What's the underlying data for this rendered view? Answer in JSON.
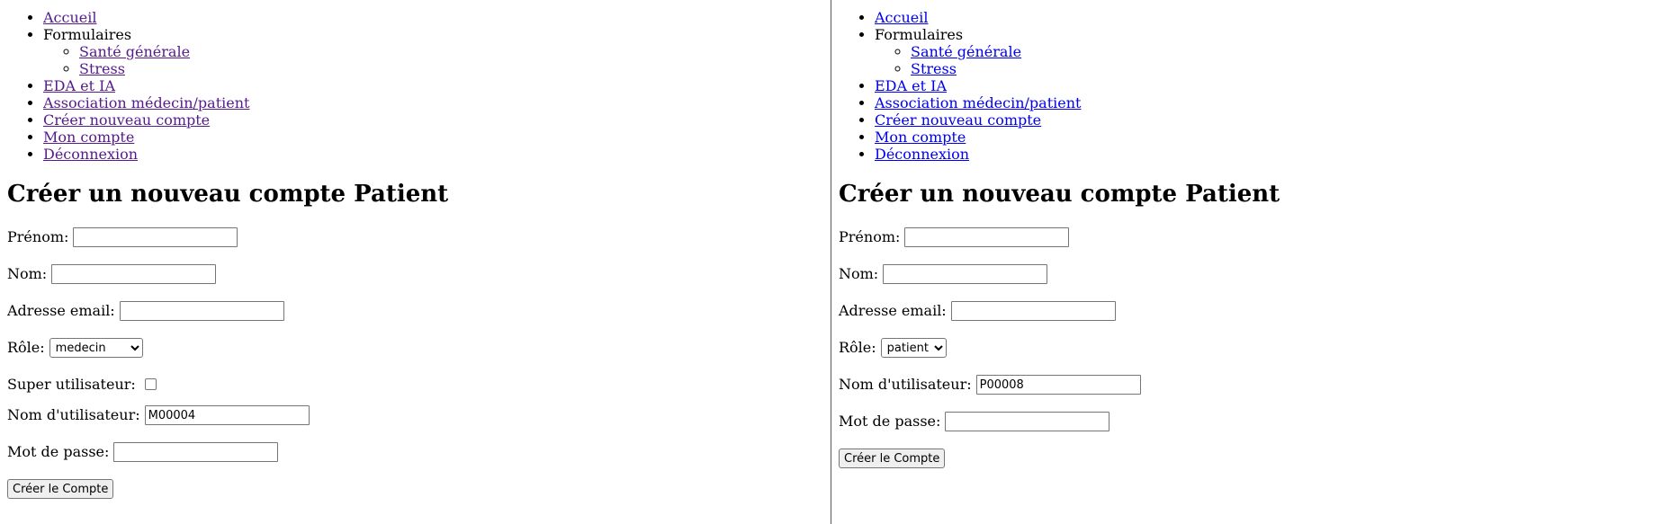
{
  "left": {
    "nav": {
      "accueil": "Accueil",
      "formulaires": "Formulaires",
      "sub": [
        "Santé générale",
        "Stress"
      ],
      "items": [
        "EDA et IA",
        "Association médecin/patient",
        "Créer nouveau compte",
        "Mon compte",
        "Déconnexion"
      ]
    },
    "title": "Créer un nouveau compte Patient",
    "form": {
      "prenom_label": "Prénom:",
      "prenom_value": "",
      "nom_label": "Nom:",
      "nom_value": "",
      "email_label": "Adresse email:",
      "email_value": "",
      "role_label": "Rôle:",
      "role_value": "medecin",
      "super_label": "Super utilisateur:",
      "super_checked": false,
      "username_label": "Nom d'utilisateur:",
      "username_value": "M00004",
      "password_label": "Mot de passe:",
      "password_value": "",
      "submit_label": "Créer le Compte"
    },
    "link_color": "#551a8b"
  },
  "right": {
    "nav": {
      "accueil": "Accueil",
      "formulaires": "Formulaires",
      "sub": [
        "Santé générale",
        "Stress"
      ],
      "items": [
        "EDA et IA",
        "Association médecin/patient",
        "Créer nouveau compte",
        "Mon compte",
        "Déconnexion"
      ]
    },
    "title": "Créer un nouveau compte Patient",
    "form": {
      "prenom_label": "Prénom:",
      "prenom_value": "",
      "nom_label": "Nom:",
      "nom_value": "",
      "email_label": "Adresse email:",
      "email_value": "",
      "role_label": "Rôle:",
      "role_value": "patient",
      "username_label": "Nom d'utilisateur:",
      "username_value": "P00008",
      "password_label": "Mot de passe:",
      "password_value": "",
      "submit_label": "Créer le Compte"
    },
    "link_color": "#0000ee"
  }
}
